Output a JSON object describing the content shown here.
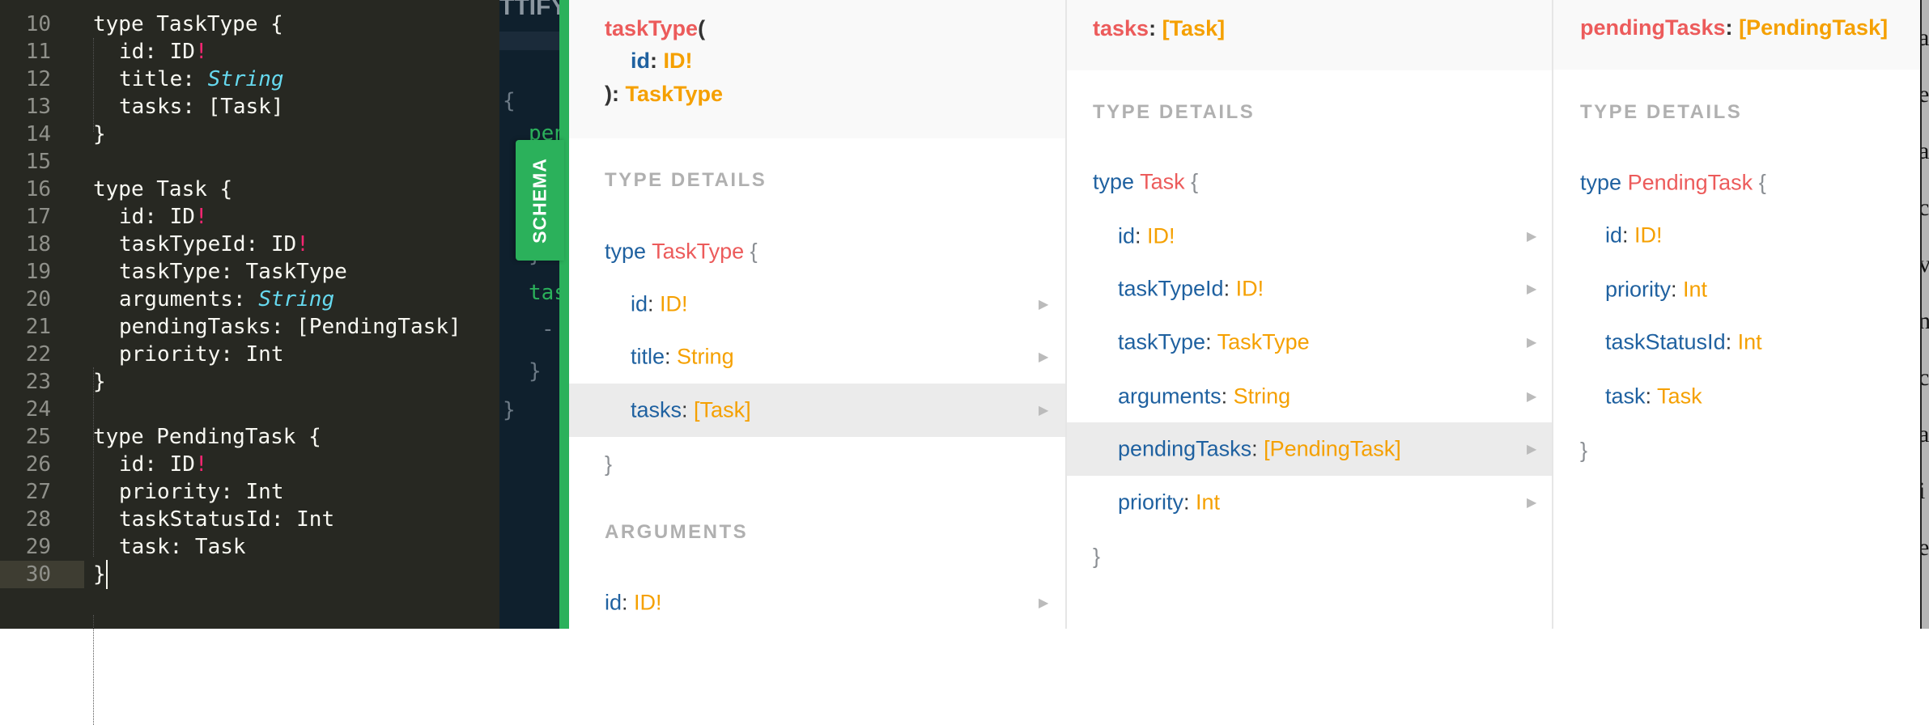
{
  "editor": {
    "lines": [
      {
        "n": "10",
        "parts": [
          [
            "type TaskType {",
            ""
          ]
        ],
        "indent": false
      },
      {
        "n": "11",
        "parts": [
          [
            "id: ID",
            ""
          ],
          [
            "!",
            "bang"
          ]
        ],
        "indent": true
      },
      {
        "n": "12",
        "parts": [
          [
            "title: ",
            ""
          ],
          [
            "String",
            "scalar"
          ]
        ],
        "indent": true
      },
      {
        "n": "13",
        "parts": [
          [
            "tasks: [Task]",
            ""
          ]
        ],
        "indent": true
      },
      {
        "n": "14",
        "parts": [
          [
            "}",
            ""
          ]
        ],
        "indent": false
      },
      {
        "n": "15",
        "parts": [],
        "indent": false
      },
      {
        "n": "16",
        "parts": [
          [
            "type Task {",
            ""
          ]
        ],
        "indent": false
      },
      {
        "n": "17",
        "parts": [
          [
            "id: ID",
            ""
          ],
          [
            "!",
            "bang"
          ]
        ],
        "indent": true
      },
      {
        "n": "18",
        "parts": [
          [
            "taskTypeId: ID",
            ""
          ],
          [
            "!",
            "bang"
          ]
        ],
        "indent": true
      },
      {
        "n": "19",
        "parts": [
          [
            "taskType: TaskType",
            ""
          ]
        ],
        "indent": true
      },
      {
        "n": "20",
        "parts": [
          [
            "arguments: ",
            ""
          ],
          [
            "String",
            "scalar"
          ]
        ],
        "indent": true
      },
      {
        "n": "21",
        "parts": [
          [
            "pendingTasks: [PendingTask]",
            ""
          ]
        ],
        "indent": true
      },
      {
        "n": "22",
        "parts": [
          [
            "priority: Int",
            ""
          ]
        ],
        "indent": true
      },
      {
        "n": "23",
        "parts": [
          [
            "}",
            ""
          ]
        ],
        "indent": false
      },
      {
        "n": "24",
        "parts": [],
        "indent": false
      },
      {
        "n": "25",
        "parts": [
          [
            "type PendingTask {",
            ""
          ]
        ],
        "indent": false
      },
      {
        "n": "26",
        "parts": [
          [
            "id: ID",
            ""
          ],
          [
            "!",
            "bang"
          ]
        ],
        "indent": true
      },
      {
        "n": "27",
        "parts": [
          [
            "priority: Int",
            ""
          ]
        ],
        "indent": true
      },
      {
        "n": "28",
        "parts": [
          [
            "taskStatusId: Int",
            ""
          ]
        ],
        "indent": true
      },
      {
        "n": "29",
        "parts": [
          [
            "task: Task",
            ""
          ]
        ],
        "indent": true
      },
      {
        "n": "30",
        "parts": [
          [
            "}",
            ""
          ]
        ],
        "indent": false
      }
    ],
    "active_line": "30"
  },
  "query_pane": {
    "prettify_label": "TTIFY",
    "fragments": [
      "{",
      "pen",
      "}",
      "tas",
      "-",
      "}",
      "}"
    ]
  },
  "schema_tab": {
    "label": "SCHEMA",
    "color": "#2bb15b"
  },
  "panel1": {
    "header": {
      "name": "taskType",
      "open": "(",
      "arg_name": "id",
      "colon": ":",
      "arg_type": "ID!",
      "close": "):",
      "return_type": "TaskType"
    },
    "type_details_label": "TYPE DETAILS",
    "type_keyword": "type",
    "type_name": "TaskType",
    "open_brace": "{",
    "close_brace": "}",
    "fields": [
      {
        "name": "id",
        "type": "ID!"
      },
      {
        "name": "title",
        "type": "String"
      },
      {
        "name": "tasks",
        "type": "[Task]",
        "selected": true
      }
    ],
    "arguments_label": "ARGUMENTS",
    "arguments": [
      {
        "name": "id",
        "type": "ID!"
      }
    ]
  },
  "panel2": {
    "header": {
      "name": "tasks",
      "colon": ":",
      "type": "[Task]"
    },
    "type_details_label": "TYPE DETAILS",
    "type_keyword": "type",
    "type_name": "Task",
    "open_brace": "{",
    "close_brace": "}",
    "fields": [
      {
        "name": "id",
        "type": "ID!"
      },
      {
        "name": "taskTypeId",
        "type": "ID!"
      },
      {
        "name": "taskType",
        "type": "TaskType"
      },
      {
        "name": "arguments",
        "type": "String"
      },
      {
        "name": "pendingTasks",
        "type": "[PendingTask]",
        "selected": true
      },
      {
        "name": "priority",
        "type": "Int"
      }
    ]
  },
  "panel3": {
    "header": {
      "name": "pendingTasks",
      "colon": ":",
      "type": "[PendingTask]"
    },
    "type_details_label": "TYPE DETAILS",
    "type_keyword": "type",
    "type_name": "PendingTask",
    "open_brace": "{",
    "close_brace": "}",
    "fields": [
      {
        "name": "id",
        "type": "ID!"
      },
      {
        "name": "priority",
        "type": "Int"
      },
      {
        "name": "taskStatusId",
        "type": "Int"
      },
      {
        "name": "task",
        "type": "Task"
      }
    ]
  },
  "edge_letters": [
    "a",
    "e",
    "a",
    "c",
    "v",
    "n",
    "c",
    "a",
    "i",
    "e"
  ],
  "colors": {
    "field": "#1f61a0",
    "type": "#f5a000",
    "name": "#ec5b5b",
    "editor_bg": "#272822",
    "selected_row": "#ebebeb"
  }
}
